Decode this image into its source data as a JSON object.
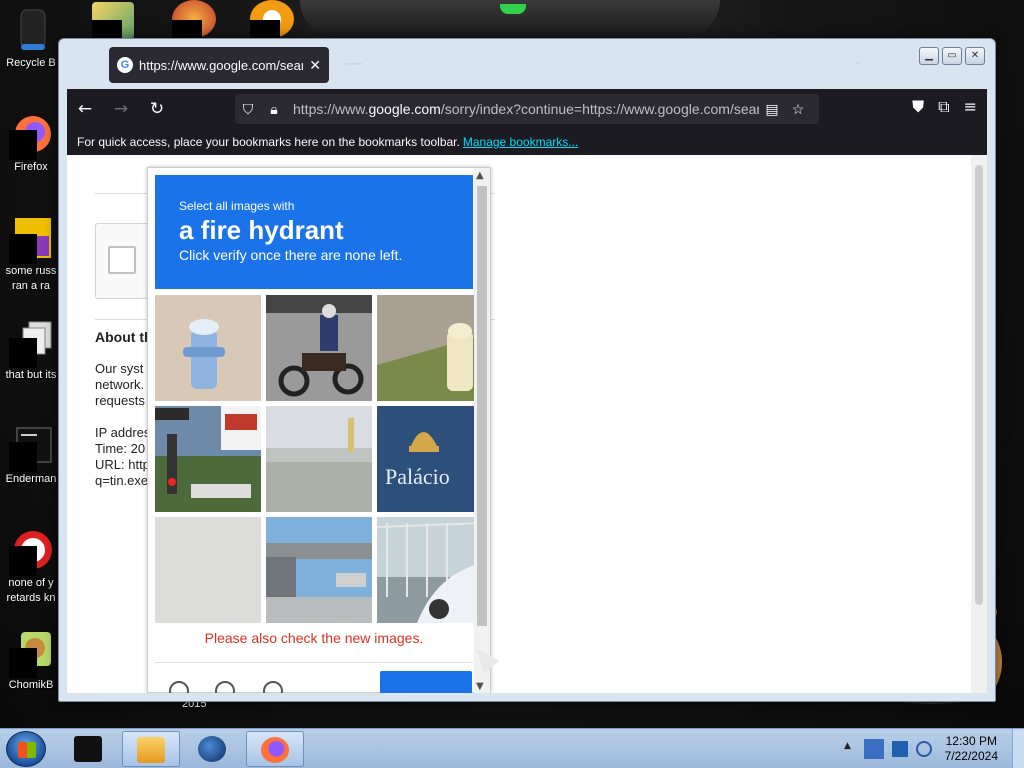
{
  "desktop": {
    "icons": [
      {
        "label": "Recycle B",
        "icon": "recycle-bin-icon"
      },
      {
        "label": "Firefox",
        "icon": "firefox-icon"
      },
      {
        "label": "some russ",
        "label2": "ran a ra",
        "icon": "winrar-icon"
      },
      {
        "label": "that but its",
        "icon": "folder-stack-icon"
      },
      {
        "label": "Enderman",
        "icon": "terminal-icon"
      },
      {
        "label": "none of y",
        "label2": "retards kn",
        "icon": "opera-icon"
      },
      {
        "label": "ChomikB",
        "icon": "hamster-icon"
      }
    ],
    "year_label": "2015"
  },
  "browser": {
    "tab_title": "https://www.google.com/search",
    "url_prefix": "https://www.",
    "url_domain": "google.com",
    "url_rest": "/sorry/index?continue=https://www.google.com/search",
    "bookmarks_hint": "For quick access, place your bookmarks here on the bookmarks toolbar.",
    "manage_bookmarks": "Manage bookmarks..."
  },
  "sorry_page": {
    "about_title": "About th",
    "lines": [
      "Our syst",
      "network.",
      "requests",
      "",
      "IP addres",
      "Time: 20",
      "URL: http",
      "q=tin.exe"
    ]
  },
  "captcha": {
    "intro": "Select all images with",
    "target": "a fire hydrant",
    "instruction": "Click verify once there are none left.",
    "warning": "Please also check the new images.",
    "tiles": [
      "fire-hydrant-blue",
      "motorcycle",
      "fire-hydrant-yellow",
      "street-sign",
      "highway",
      "palacio-sign",
      "blank",
      "bridge",
      "fence-car"
    ],
    "tile_text_palacio": "Palácio"
  },
  "taskbar": {
    "time": "12:30 PM",
    "date": "7/22/2024"
  },
  "colors": {
    "captcha_blue": "#1a73e8",
    "warning_red": "#d93025",
    "taskbar": "#b9cfe8"
  }
}
